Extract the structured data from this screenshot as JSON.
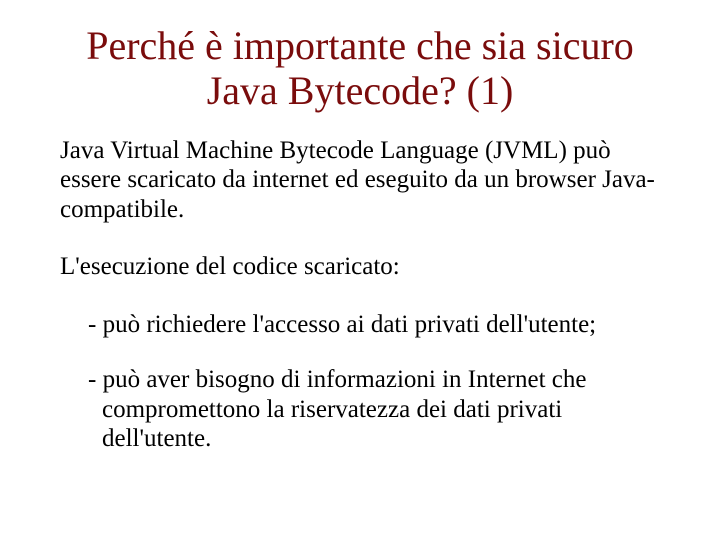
{
  "title": "Perché è importante che sia sicuro Java Bytecode? (1)",
  "paragraphs": {
    "p1": "Java Virtual Machine Bytecode Language (JVML) può essere scaricato da internet ed eseguito da un browser Java-compatibile.",
    "p2": "L'esecuzione del codice scaricato:"
  },
  "bullets": {
    "b1": "- può richiedere l'accesso ai dati privati dell'utente;",
    "b2": "- può aver bisogno di informazioni in Internet che compromettono la riservatezza dei dati privati dell'utente."
  }
}
